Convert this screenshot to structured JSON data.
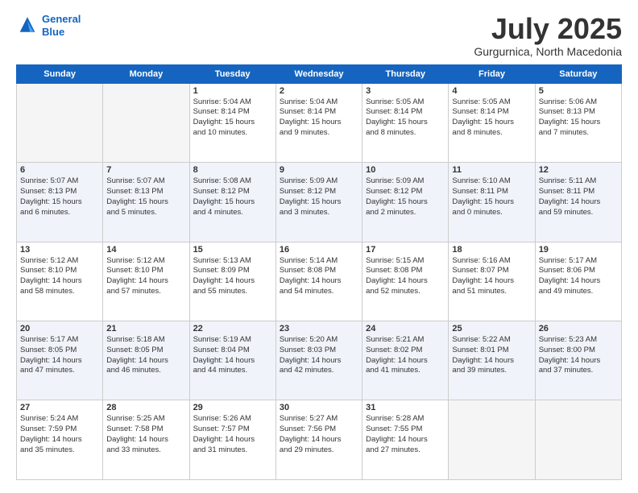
{
  "logo": {
    "line1": "General",
    "line2": "Blue"
  },
  "title": "July 2025",
  "subtitle": "Gurgurnica, North Macedonia",
  "headers": [
    "Sunday",
    "Monday",
    "Tuesday",
    "Wednesday",
    "Thursday",
    "Friday",
    "Saturday"
  ],
  "weeks": [
    [
      {
        "day": "",
        "lines": [],
        "empty": true
      },
      {
        "day": "",
        "lines": [],
        "empty": true
      },
      {
        "day": "1",
        "lines": [
          "Sunrise: 5:04 AM",
          "Sunset: 8:14 PM",
          "Daylight: 15 hours",
          "and 10 minutes."
        ]
      },
      {
        "day": "2",
        "lines": [
          "Sunrise: 5:04 AM",
          "Sunset: 8:14 PM",
          "Daylight: 15 hours",
          "and 9 minutes."
        ]
      },
      {
        "day": "3",
        "lines": [
          "Sunrise: 5:05 AM",
          "Sunset: 8:14 PM",
          "Daylight: 15 hours",
          "and 8 minutes."
        ]
      },
      {
        "day": "4",
        "lines": [
          "Sunrise: 5:05 AM",
          "Sunset: 8:14 PM",
          "Daylight: 15 hours",
          "and 8 minutes."
        ]
      },
      {
        "day": "5",
        "lines": [
          "Sunrise: 5:06 AM",
          "Sunset: 8:13 PM",
          "Daylight: 15 hours",
          "and 7 minutes."
        ]
      }
    ],
    [
      {
        "day": "6",
        "lines": [
          "Sunrise: 5:07 AM",
          "Sunset: 8:13 PM",
          "Daylight: 15 hours",
          "and 6 minutes."
        ]
      },
      {
        "day": "7",
        "lines": [
          "Sunrise: 5:07 AM",
          "Sunset: 8:13 PM",
          "Daylight: 15 hours",
          "and 5 minutes."
        ]
      },
      {
        "day": "8",
        "lines": [
          "Sunrise: 5:08 AM",
          "Sunset: 8:12 PM",
          "Daylight: 15 hours",
          "and 4 minutes."
        ]
      },
      {
        "day": "9",
        "lines": [
          "Sunrise: 5:09 AM",
          "Sunset: 8:12 PM",
          "Daylight: 15 hours",
          "and 3 minutes."
        ]
      },
      {
        "day": "10",
        "lines": [
          "Sunrise: 5:09 AM",
          "Sunset: 8:12 PM",
          "Daylight: 15 hours",
          "and 2 minutes."
        ]
      },
      {
        "day": "11",
        "lines": [
          "Sunrise: 5:10 AM",
          "Sunset: 8:11 PM",
          "Daylight: 15 hours",
          "and 0 minutes."
        ]
      },
      {
        "day": "12",
        "lines": [
          "Sunrise: 5:11 AM",
          "Sunset: 8:11 PM",
          "Daylight: 14 hours",
          "and 59 minutes."
        ]
      }
    ],
    [
      {
        "day": "13",
        "lines": [
          "Sunrise: 5:12 AM",
          "Sunset: 8:10 PM",
          "Daylight: 14 hours",
          "and 58 minutes."
        ]
      },
      {
        "day": "14",
        "lines": [
          "Sunrise: 5:12 AM",
          "Sunset: 8:10 PM",
          "Daylight: 14 hours",
          "and 57 minutes."
        ]
      },
      {
        "day": "15",
        "lines": [
          "Sunrise: 5:13 AM",
          "Sunset: 8:09 PM",
          "Daylight: 14 hours",
          "and 55 minutes."
        ]
      },
      {
        "day": "16",
        "lines": [
          "Sunrise: 5:14 AM",
          "Sunset: 8:08 PM",
          "Daylight: 14 hours",
          "and 54 minutes."
        ]
      },
      {
        "day": "17",
        "lines": [
          "Sunrise: 5:15 AM",
          "Sunset: 8:08 PM",
          "Daylight: 14 hours",
          "and 52 minutes."
        ]
      },
      {
        "day": "18",
        "lines": [
          "Sunrise: 5:16 AM",
          "Sunset: 8:07 PM",
          "Daylight: 14 hours",
          "and 51 minutes."
        ]
      },
      {
        "day": "19",
        "lines": [
          "Sunrise: 5:17 AM",
          "Sunset: 8:06 PM",
          "Daylight: 14 hours",
          "and 49 minutes."
        ]
      }
    ],
    [
      {
        "day": "20",
        "lines": [
          "Sunrise: 5:17 AM",
          "Sunset: 8:05 PM",
          "Daylight: 14 hours",
          "and 47 minutes."
        ]
      },
      {
        "day": "21",
        "lines": [
          "Sunrise: 5:18 AM",
          "Sunset: 8:05 PM",
          "Daylight: 14 hours",
          "and 46 minutes."
        ]
      },
      {
        "day": "22",
        "lines": [
          "Sunrise: 5:19 AM",
          "Sunset: 8:04 PM",
          "Daylight: 14 hours",
          "and 44 minutes."
        ]
      },
      {
        "day": "23",
        "lines": [
          "Sunrise: 5:20 AM",
          "Sunset: 8:03 PM",
          "Daylight: 14 hours",
          "and 42 minutes."
        ]
      },
      {
        "day": "24",
        "lines": [
          "Sunrise: 5:21 AM",
          "Sunset: 8:02 PM",
          "Daylight: 14 hours",
          "and 41 minutes."
        ]
      },
      {
        "day": "25",
        "lines": [
          "Sunrise: 5:22 AM",
          "Sunset: 8:01 PM",
          "Daylight: 14 hours",
          "and 39 minutes."
        ]
      },
      {
        "day": "26",
        "lines": [
          "Sunrise: 5:23 AM",
          "Sunset: 8:00 PM",
          "Daylight: 14 hours",
          "and 37 minutes."
        ]
      }
    ],
    [
      {
        "day": "27",
        "lines": [
          "Sunrise: 5:24 AM",
          "Sunset: 7:59 PM",
          "Daylight: 14 hours",
          "and 35 minutes."
        ]
      },
      {
        "day": "28",
        "lines": [
          "Sunrise: 5:25 AM",
          "Sunset: 7:58 PM",
          "Daylight: 14 hours",
          "and 33 minutes."
        ]
      },
      {
        "day": "29",
        "lines": [
          "Sunrise: 5:26 AM",
          "Sunset: 7:57 PM",
          "Daylight: 14 hours",
          "and 31 minutes."
        ]
      },
      {
        "day": "30",
        "lines": [
          "Sunrise: 5:27 AM",
          "Sunset: 7:56 PM",
          "Daylight: 14 hours",
          "and 29 minutes."
        ]
      },
      {
        "day": "31",
        "lines": [
          "Sunrise: 5:28 AM",
          "Sunset: 7:55 PM",
          "Daylight: 14 hours",
          "and 27 minutes."
        ]
      },
      {
        "day": "",
        "lines": [],
        "empty": true
      },
      {
        "day": "",
        "lines": [],
        "empty": true
      }
    ]
  ]
}
